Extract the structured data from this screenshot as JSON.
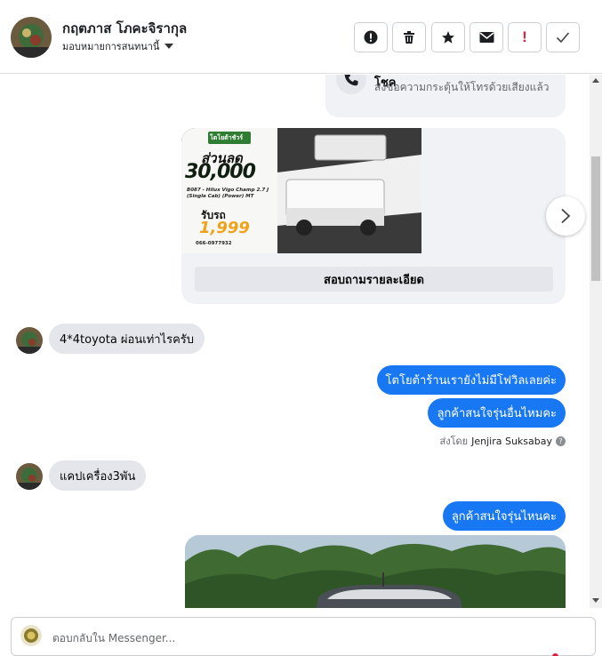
{
  "header": {
    "contact_name": "กฤตภาส โภคะจิรากุล",
    "assign_label": "มอบหมายการสนทนานี้"
  },
  "toolbar": {
    "buttons": [
      {
        "icon": "alert-circle-icon"
      },
      {
        "icon": "trash-icon"
      },
      {
        "icon": "star-icon"
      },
      {
        "icon": "envelope-icon"
      },
      {
        "icon": "exclamation-icon",
        "glyph": "!"
      },
      {
        "icon": "check-icon"
      }
    ]
  },
  "callcard": {
    "title": "โทรหา ติดต่อเพื่อขอข้อมูลเพิ่มเติม โชค",
    "subtitle": "ส่งข้อความกระตุ้นให้โทรด้วยเสียงแล้ว"
  },
  "product": {
    "badge": "โตโยต้าชัวร์",
    "promo_title": "ส่วนลด",
    "promo_amount": "30,000",
    "model": "B087 - Hilux Vigo Champ 2.7 J (Single Cab) (Power) MT",
    "price_label": "รับรถ",
    "price": "1,999",
    "contact": "066-0977932",
    "button_label": "สอบถามรายละเอียด"
  },
  "messages": [
    {
      "dir": "in",
      "text": "4*4toyota ผ่อนเท่าไรครับ"
    },
    {
      "dir": "out",
      "text": "โตโยต้าร้านเรายังไม่มีโฟวิลเลยค่ะ"
    },
    {
      "dir": "out",
      "text": "ลูกค้าสนใจรุ่นอื่นไหมคะ"
    },
    {
      "dir": "in",
      "text": "แคปเครื่อง3พัน"
    },
    {
      "dir": "out",
      "text": "ลูกค้าสนใจรุ่นไหนคะ"
    }
  ],
  "sent_by": {
    "prefix": "ส่งโดย",
    "name": "Jenjira Suksabay"
  },
  "composer": {
    "placeholder": "ตอบกลับใน Messenger..."
  },
  "colors": {
    "accent": "#1877f2",
    "incoming_bubble": "#e4e6eb",
    "alert_red": "#e41e3f"
  }
}
